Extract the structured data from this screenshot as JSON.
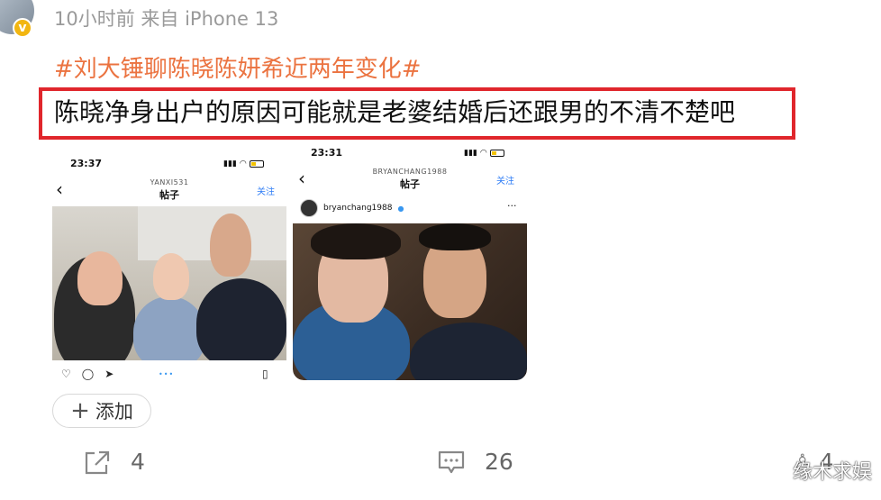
{
  "post": {
    "meta": "10小时前 来自 iPhone 13",
    "hashtag": "#刘大锤聊陈晓陈妍希近两年变化#",
    "caption": "陈晓净身出户的原因可能就是老婆结婚后还跟男的不清不楚吧"
  },
  "screenshot1": {
    "time": "23:37",
    "account": "YANXI531",
    "title": "帖子",
    "follow": "关注"
  },
  "screenshot2": {
    "time": "23:31",
    "account": "BRYANCHANG1988",
    "title": "帖子",
    "follow": "关注",
    "username": "bryanchang1988"
  },
  "add_button": {
    "label": "添加"
  },
  "stats": {
    "share_count": "4",
    "comment_count": "26",
    "like_count": "4"
  },
  "watermark": "缘木求娱",
  "colors": {
    "hashtag": "#eb7340",
    "highlight_box": "#e0262c",
    "link": "#2f7df6"
  }
}
